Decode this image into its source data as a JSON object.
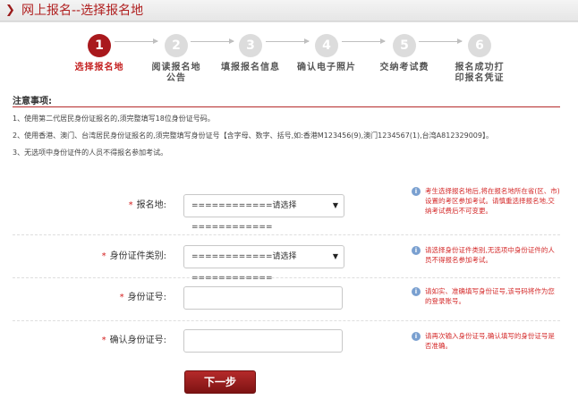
{
  "header": {
    "title": "网上报名--选择报名地"
  },
  "steps": [
    {
      "number": "1",
      "label": "选择报名地"
    },
    {
      "number": "2",
      "label": "阅读报名地公告"
    },
    {
      "number": "3",
      "label": "填报报名信息"
    },
    {
      "number": "4",
      "label": "确认电子照片"
    },
    {
      "number": "5",
      "label": "交纳考试费"
    },
    {
      "number": "6",
      "label": "报名成功打印报名凭证"
    }
  ],
  "active_step": 1,
  "notice": {
    "title": "注意事项:",
    "items": [
      "1、使用第二代居民身份证报名的,须完整填写18位身份证号码。",
      "2、使用香港、澳门、台湾居民身份证报名的,须完整填写身份证号【含字母、数字、括号,如:香港M123456(9),澳门1234567(1),台湾A812329009】。",
      "3、无选项中身份证件的人员不得报名参加考试。"
    ]
  },
  "form": {
    "required_mark": "*",
    "fields": [
      {
        "label": "报名地:",
        "type": "select",
        "value": "============请选择============",
        "hint": "考生选择报名地后,将在报名地所在省(区、市)设置的考区参加考试。请慎重选择报名地,交纳考试费后不可变更。"
      },
      {
        "label": "身份证件类别:",
        "type": "select",
        "value": "============请选择============",
        "hint": "请选择身份证件类别,无选项中身份证件的人员不得报名参加考试。"
      },
      {
        "label": "身份证号:",
        "type": "text",
        "value": "",
        "hint": "请如实、准确填写身份证号,该号码将作为您的登录账号。"
      },
      {
        "label": "确认身份证号:",
        "type": "text",
        "value": "",
        "hint": "请再次输入身份证号,确认填写的身份证号是否准确。"
      }
    ],
    "submit_label": "下一步"
  },
  "icons": {
    "header": "chevron-right-icon",
    "hint": "info-icon",
    "select": "caret-down-icon"
  },
  "colors": {
    "accent": "#a9191d",
    "hint_text": "#d42a2a",
    "inactive_step": "#dcdcdc"
  }
}
